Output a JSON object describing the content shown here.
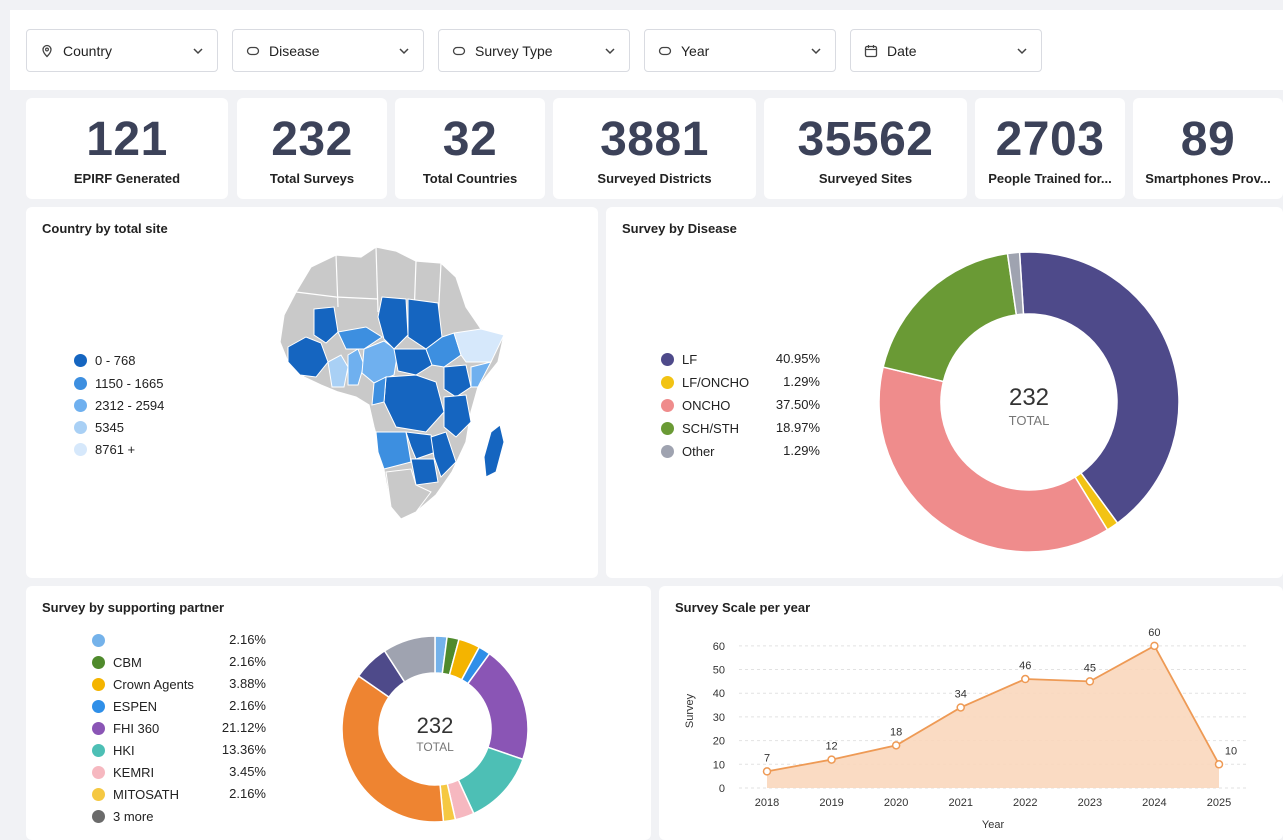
{
  "filters": [
    {
      "label": "Country",
      "icon": "location-pin-icon"
    },
    {
      "label": "Disease",
      "icon": "tag-icon"
    },
    {
      "label": "Survey Type",
      "icon": "tag-icon"
    },
    {
      "label": "Year",
      "icon": "tag-icon"
    },
    {
      "label": "Date",
      "icon": "calendar-icon"
    }
  ],
  "kpis": [
    {
      "value": "121",
      "label": "EPIRF Generated"
    },
    {
      "value": "232",
      "label": "Total Surveys"
    },
    {
      "value": "32",
      "label": "Total Countries"
    },
    {
      "value": "3881",
      "label": "Surveyed Districts"
    },
    {
      "value": "35562",
      "label": "Surveyed Sites"
    },
    {
      "value": "2703",
      "label": "People Trained for..."
    },
    {
      "value": "89",
      "label": "Smartphones Prov..."
    }
  ],
  "map_panel": {
    "title": "Country by total site",
    "legend": [
      {
        "label": "0 - 768",
        "color": "#1565c0"
      },
      {
        "label": "1150 - 1665",
        "color": "#3d8fe0"
      },
      {
        "label": "2312 - 2594",
        "color": "#6fb0ef"
      },
      {
        "label": "5345",
        "color": "#a9d0f5"
      },
      {
        "label": "8761 +",
        "color": "#d6e8fb"
      }
    ]
  },
  "disease_panel": {
    "title": "Survey by Disease",
    "total_value": "232",
    "total_label": "TOTAL"
  },
  "partner_panel": {
    "title": "Survey by supporting partner",
    "total_value": "232",
    "total_label": "TOTAL"
  },
  "scale_panel": {
    "title": "Survey Scale per year"
  },
  "chart_data": [
    {
      "type": "pie",
      "title": "Survey by Disease",
      "categories": [
        "LF",
        "LF/ONCHO",
        "ONCHO",
        "SCH/STH",
        "Other"
      ],
      "values": [
        40.95,
        1.29,
        37.5,
        18.97,
        1.29
      ],
      "labels": [
        "40.95%",
        "1.29%",
        "37.50%",
        "18.97%",
        "1.29%"
      ],
      "colors": [
        "#4e4a8a",
        "#f2c314",
        "#ef8c8c",
        "#6a9a35",
        "#9fa3b0"
      ]
    },
    {
      "type": "pie",
      "title": "Survey by supporting partner",
      "categories": [
        "",
        "CBM",
        "Crown Agents",
        "ESPEN",
        "FHI 360",
        "HKI",
        "KEMRI",
        "MITOSATH",
        "3 more"
      ],
      "values": [
        2.16,
        2.16,
        3.88,
        2.16,
        21.12,
        13.36,
        3.45,
        2.16
      ],
      "labels": [
        "2.16%",
        "2.16%",
        "3.88%",
        "2.16%",
        "21.12%",
        "13.36%",
        "3.45%",
        "2.16%"
      ],
      "colors": [
        "#74b2ea",
        "#4f8a2c",
        "#f4b400",
        "#2f8fe8",
        "#8a55b5",
        "#4dbfb5",
        "#f6b8c0",
        "#f5c842",
        "#6b6b6b"
      ],
      "hidden_slices": [
        {
          "value": 37.5,
          "color": "#ee8431"
        },
        {
          "value": 6.47,
          "color": "#4e4a8a"
        },
        {
          "value": 9.48,
          "color": "#9fa3b0"
        }
      ]
    },
    {
      "type": "area",
      "title": "Survey Scale per year",
      "xlabel": "Year",
      "ylabel": "Survey",
      "x": [
        "2018",
        "2019",
        "2020",
        "2021",
        "2022",
        "2023",
        "2024",
        "2025"
      ],
      "values": [
        7,
        12,
        18,
        34,
        46,
        45,
        60,
        10
      ],
      "yticks": [
        0,
        10,
        20,
        30,
        40,
        50,
        60
      ],
      "ylim": [
        0,
        65
      ],
      "grid": true,
      "color": "#ee9a55"
    }
  ]
}
